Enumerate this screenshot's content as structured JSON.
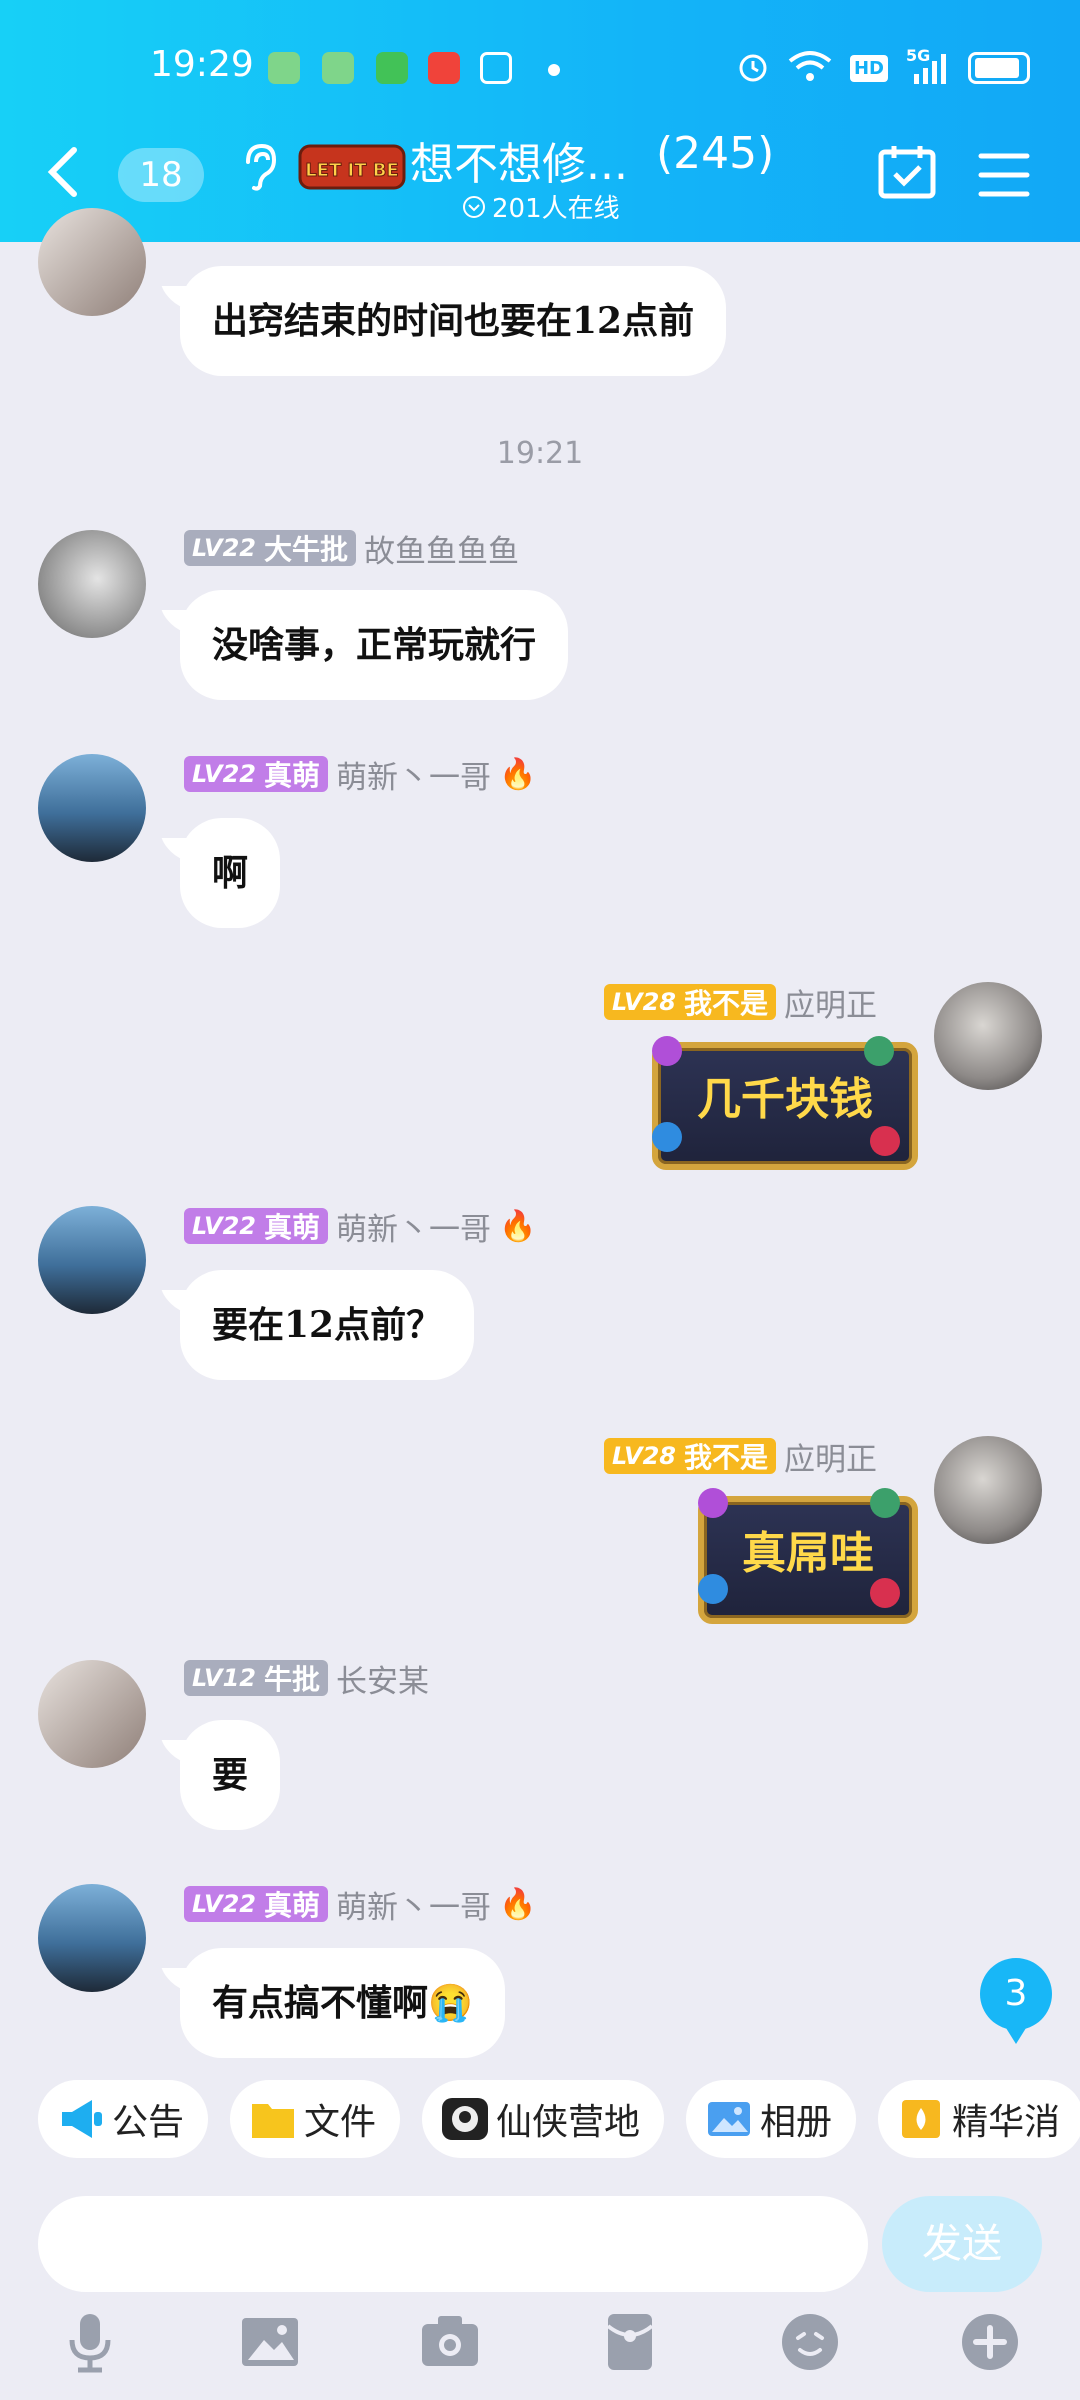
{
  "status_bar": {
    "time": "19:29",
    "hd": "HD",
    "network": "5G"
  },
  "header": {
    "back_count": "18",
    "logo_text": "LET IT BE",
    "group_name": "想不想修...",
    "member_count": "(245)",
    "online_text": "201人在线"
  },
  "messages": [
    {
      "text": "出窍结束的时间也要在12点前"
    },
    {
      "timestamp": "19:21"
    },
    {
      "level": "LV22",
      "title": "大牛批",
      "nick": "故鱼鱼鱼鱼",
      "text": "没啥事，正常玩就行",
      "badge_color": "#a9adbd"
    },
    {
      "level": "LV22",
      "title": "真萌",
      "nick": "萌新丶一哥",
      "text": "啊",
      "badge_color": "#c17de8"
    },
    {
      "level": "LV28",
      "title": "我不是",
      "nick": "应明正",
      "sticker": "几千块钱",
      "badge_color": "#f7b81f"
    },
    {
      "level": "LV22",
      "title": "真萌",
      "nick": "萌新丶一哥",
      "text": "要在12点前？",
      "badge_color": "#c17de8"
    },
    {
      "level": "LV28",
      "title": "我不是",
      "nick": "应明正",
      "sticker": "真屌哇",
      "badge_color": "#f7b81f"
    },
    {
      "level": "LV12",
      "title": "牛批",
      "nick": "长安某",
      "text": "要",
      "badge_color": "#a9adbd"
    },
    {
      "level": "LV22",
      "title": "真萌",
      "nick": "萌新丶一哥",
      "text": "有点搞不懂啊",
      "emoji": "😭",
      "badge_color": "#c17de8"
    }
  ],
  "unread_count": "3",
  "shortcuts": [
    {
      "label": "公告",
      "icon": "megaphone-icon"
    },
    {
      "label": "文件",
      "icon": "folder-icon"
    },
    {
      "label": "仙侠营地",
      "icon": "game-icon"
    },
    {
      "label": "相册",
      "icon": "album-icon"
    },
    {
      "label": "精华消",
      "icon": "essence-icon"
    }
  ],
  "composer": {
    "send_label": "发送"
  },
  "colors": {
    "header_start": "#17d0f7",
    "header_end": "#12a8f6",
    "accent": "#18b7f7",
    "background": "#ececf4"
  }
}
